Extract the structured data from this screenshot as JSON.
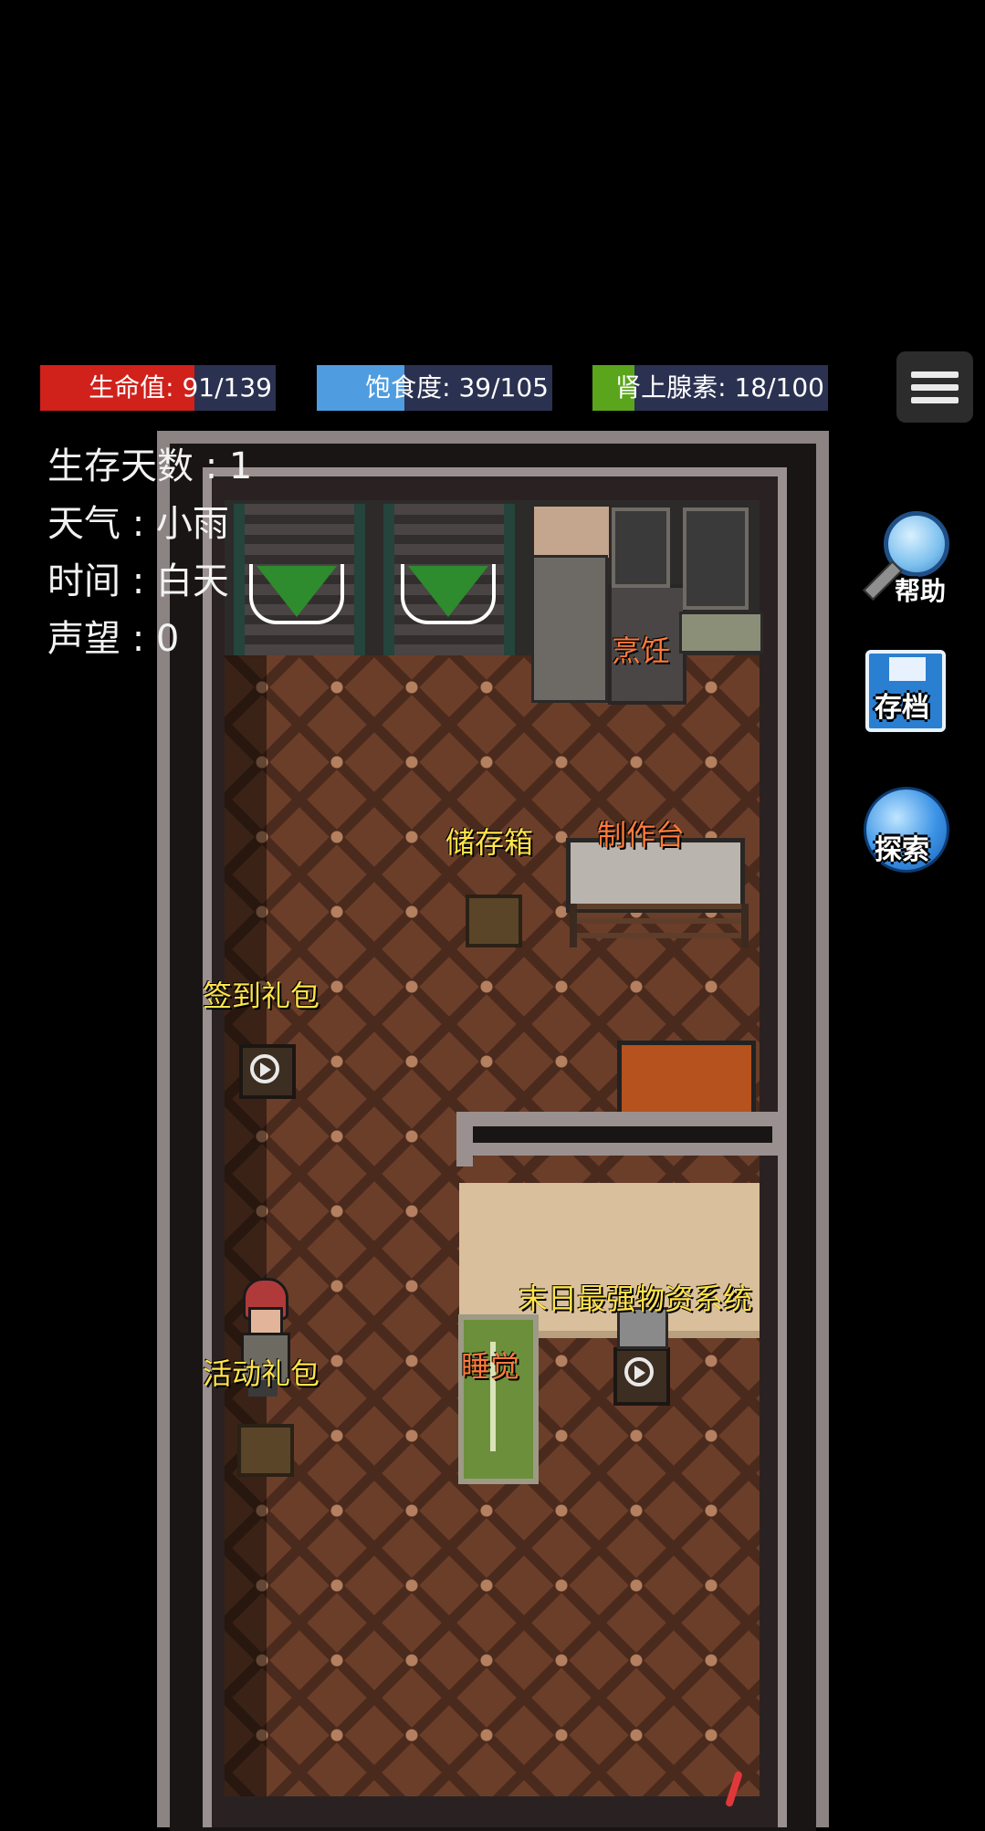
{
  "status_bars": {
    "health": {
      "label": "生命值: 91/139",
      "current": 91,
      "max": 139,
      "color": "#d0211b"
    },
    "hunger": {
      "label": "饱食度: 39/105",
      "current": 39,
      "max": 105,
      "color": "#4f9de0"
    },
    "adrenaline": {
      "label": "肾上腺素: 18/100",
      "current": 18,
      "max": 100,
      "color": "#5aa51c"
    }
  },
  "stats": {
    "days": "生存天数 : 1",
    "weather": "天气 : 小雨",
    "time": "时间 : 白天",
    "reputation": "声望 : 0"
  },
  "map_labels": {
    "cooking": "烹饪",
    "storage": "储存箱",
    "workbench": "制作台",
    "checkin_gift": "签到礼包",
    "event_gift": "活动礼包",
    "sleep": "睡觉",
    "supply_system": "末日最强物资系统"
  },
  "side_buttons": {
    "help": "帮助",
    "save": "存档",
    "explore": "探索"
  },
  "icons": [
    "menu-icon",
    "magnifier-icon",
    "floppy-disk-icon",
    "globe-icon",
    "play-icon",
    "down-arrow-icon"
  ]
}
